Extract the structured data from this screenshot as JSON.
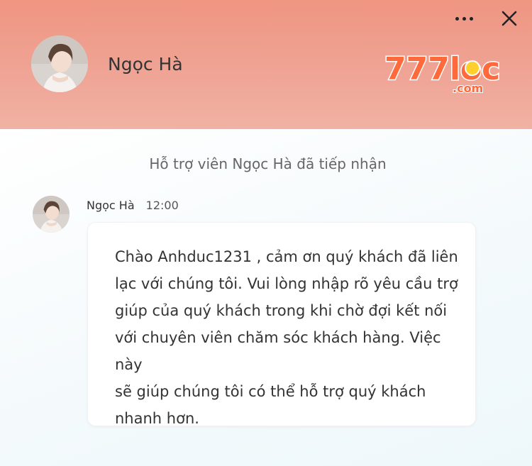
{
  "header": {
    "agent_name": "Ngọc Hà",
    "logo": {
      "brand_text": "777loc",
      "domain_text": ".com",
      "colors": {
        "primary": "#ff6a3d",
        "accent": "#ffcf2e",
        "outline": "#ffffff"
      }
    },
    "icons": {
      "more": "more-horizontal-icon",
      "close": "close-icon"
    }
  },
  "chat": {
    "system_note": "Hỗ trợ viên Ngọc Hà đã tiếp nhận",
    "messages": [
      {
        "sender": "Ngọc Hà",
        "time": "12:00",
        "text": "Chào Anhduc1231 , cảm ơn quý khách đã liên\nlạc với chúng tôi. Vui lòng nhập rõ yêu cầu trợ\ngiúp của quý khách trong khi chờ đợi kết nối\nvới chuyên viên chăm sóc khách hàng. Việc này\nsẽ giúp chúng tôi có thể hỗ trợ quý khách\nnhanh hơn."
      }
    ]
  },
  "colors": {
    "header_bg": "#ef9a87",
    "chat_bg": "#f5fafc",
    "bubble_bg": "#ffffff",
    "text": "#333333"
  }
}
